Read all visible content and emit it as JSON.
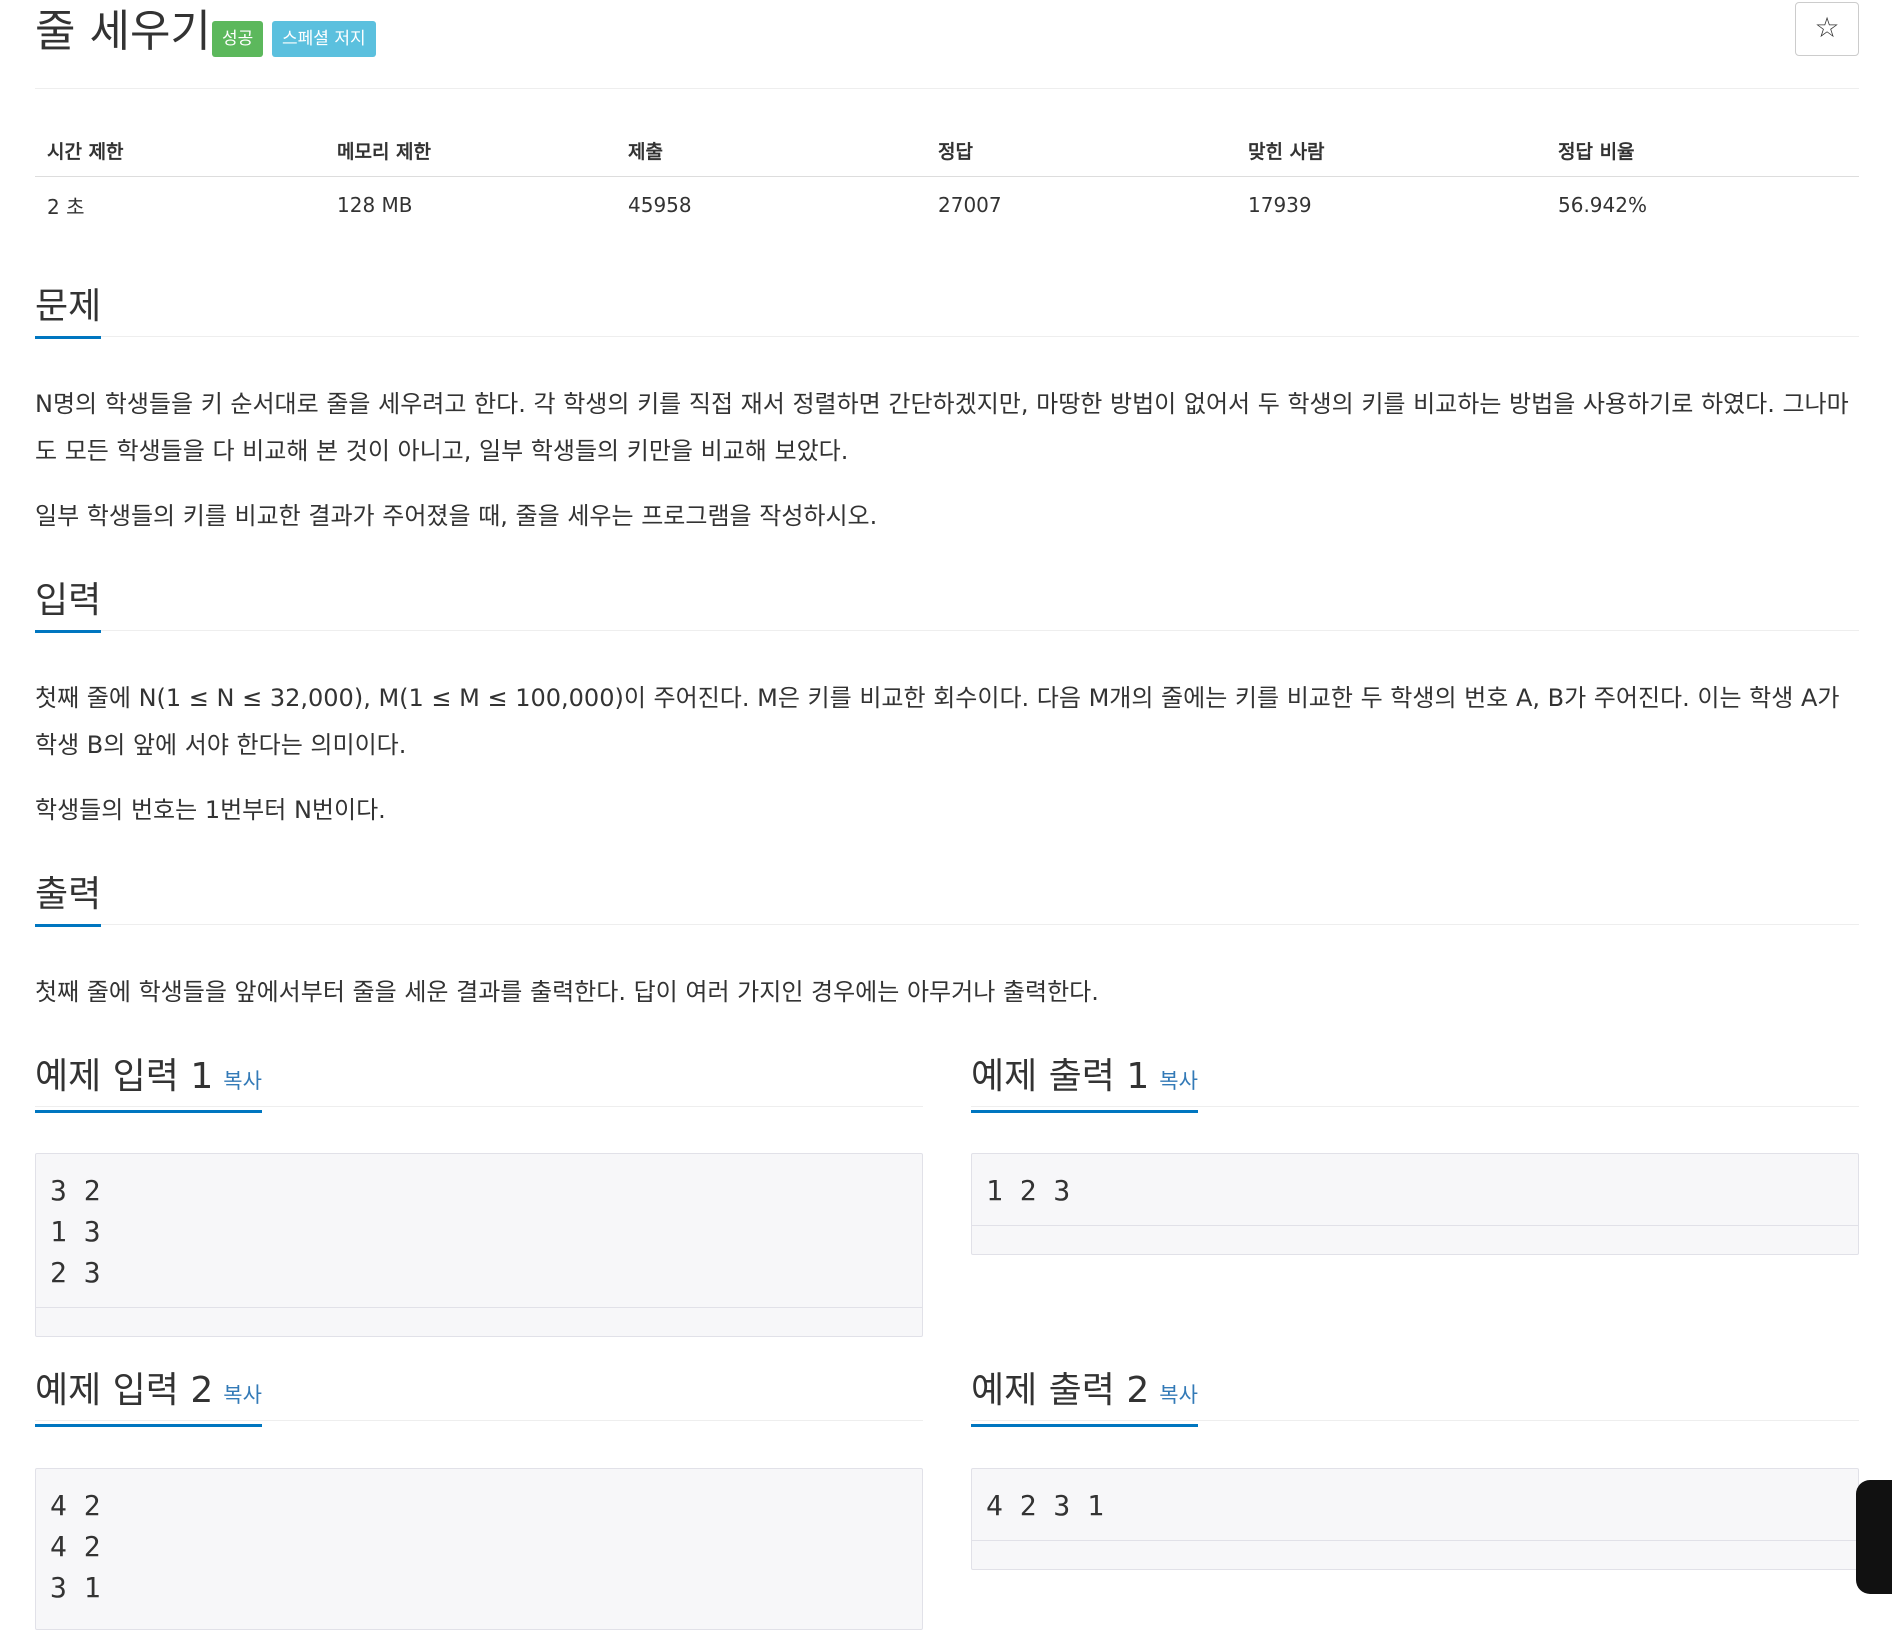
{
  "problem": {
    "title": "줄 세우기",
    "badges": {
      "success": "성공",
      "special": "스페셜 저지"
    },
    "star_icon": "☆"
  },
  "info": {
    "headers": [
      "시간 제한",
      "메모리 제한",
      "제출",
      "정답",
      "맞힌 사람",
      "정답 비율"
    ],
    "values": [
      "2 초",
      "128 MB",
      "45958",
      "27007",
      "17939",
      "56.942%"
    ]
  },
  "sections": {
    "problem": {
      "heading": "문제",
      "p1": "N명의 학생들을 키 순서대로 줄을 세우려고 한다. 각 학생의 키를 직접 재서 정렬하면 간단하겠지만, 마땅한 방법이 없어서 두 학생의 키를 비교하는 방법을 사용하기로 하였다. 그나마도 모든 학생들을 다 비교해 본 것이 아니고, 일부 학생들의 키만을 비교해 보았다.",
      "p2": "일부 학생들의 키를 비교한 결과가 주어졌을 때, 줄을 세우는 프로그램을 작성하시오."
    },
    "input": {
      "heading": "입력",
      "p1": "첫째 줄에 N(1 ≤ N ≤ 32,000), M(1 ≤ M ≤ 100,000)이 주어진다. M은 키를 비교한 회수이다. 다음 M개의 줄에는 키를 비교한 두 학생의 번호 A, B가 주어진다. 이는 학생 A가 학생 B의 앞에 서야 한다는 의미이다.",
      "p2": "학생들의 번호는 1번부터 N번이다."
    },
    "output": {
      "heading": "출력",
      "p1": "첫째 줄에 학생들을 앞에서부터 줄을 세운 결과를 출력한다. 답이 여러 가지인 경우에는 아무거나 출력한다."
    }
  },
  "samples": {
    "copy_label": "복사",
    "input1": {
      "heading": "예제 입력 1",
      "text": "3 2\n1 3\n2 3"
    },
    "output1": {
      "heading": "예제 출력 1",
      "text": "1 2 3"
    },
    "input2": {
      "heading": "예제 입력 2",
      "text": "4 2\n4 2\n3 1"
    },
    "output2": {
      "heading": "예제 출력 2",
      "text": "4 2 3 1"
    }
  }
}
